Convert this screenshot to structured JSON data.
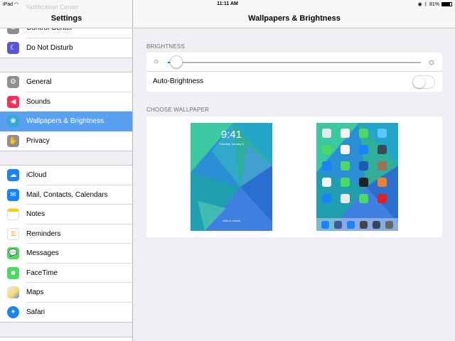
{
  "status_bar": {
    "device": "iPad",
    "time": "11:11 AM",
    "battery_text": "81%",
    "battery_level": 0.81
  },
  "sidebar": {
    "title": "Settings",
    "faded_header_label": "Notification Center",
    "groups": [
      {
        "items": [
          {
            "label": "Control Center",
            "icon": "control-center-icon",
            "color": "#8e8e93"
          },
          {
            "label": "Do Not Disturb",
            "icon": "moon-icon",
            "color": "#5856d6"
          }
        ]
      },
      {
        "items": [
          {
            "label": "General",
            "icon": "gear-icon",
            "color": "#8e8e93"
          },
          {
            "label": "Sounds",
            "icon": "speaker-icon",
            "color": "#ff2d55"
          },
          {
            "label": "Wallpapers & Brightness",
            "icon": "flower-icon",
            "color": "#34aadc",
            "selected": true
          },
          {
            "label": "Privacy",
            "icon": "hand-icon",
            "color": "#8e8e93"
          }
        ]
      },
      {
        "items": [
          {
            "label": "iCloud",
            "icon": "cloud-icon",
            "color": "#1a82fb"
          },
          {
            "label": "Mail, Contacts, Calendars",
            "icon": "envelope-icon",
            "color": "#1a82fb"
          },
          {
            "label": "Notes",
            "icon": "notes-icon",
            "color": "#ffcc00"
          },
          {
            "label": "Reminders",
            "icon": "list-icon",
            "color": "#ffffff"
          },
          {
            "label": "Messages",
            "icon": "speech-bubble-icon",
            "color": "#4cd964"
          },
          {
            "label": "FaceTime",
            "icon": "video-camera-icon",
            "color": "#4cd964"
          },
          {
            "label": "Maps",
            "icon": "map-icon",
            "color": "#f2f2f2"
          },
          {
            "label": "Safari",
            "icon": "compass-icon",
            "color": "#1a82fb"
          }
        ]
      }
    ]
  },
  "main": {
    "title": "Wallpapers & Brightness",
    "brightness_section": "BRIGHTNESS",
    "brightness_level": 0.02,
    "auto_brightness_label": "Auto-Brightness",
    "auto_brightness_on": false,
    "wallpaper_section": "CHOOSE WALLPAPER",
    "lock_screen": {
      "time": "9:41",
      "date": "Tuesday, January 9",
      "slide_text": "slide to unlock"
    }
  },
  "colors": {
    "accent": "#007aff",
    "selected_row": "#5aa0f0"
  }
}
